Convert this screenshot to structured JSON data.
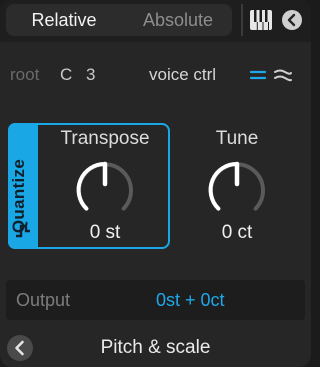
{
  "mode_tabs": [
    {
      "label": "Relative",
      "active": true
    },
    {
      "label": "Absolute",
      "active": false
    }
  ],
  "icons": {
    "keyboard": "piano-keyboard-icon",
    "back_top": "chevron-left-circle-icon",
    "voice_parallel": "parallel-lines-icon",
    "voice_wavy": "wavy-lines-icon",
    "quantize_step": "step-icon",
    "back_bottom": "chevron-left-circle-icon"
  },
  "root": {
    "label": "root",
    "note": "C",
    "octave": "3"
  },
  "voice": {
    "label": "voice ctrl"
  },
  "quantize": {
    "label": "Quantize",
    "enabled": true
  },
  "transpose": {
    "title": "Transpose",
    "value": "0 st"
  },
  "tune": {
    "title": "Tune",
    "value": "0 ct"
  },
  "output": {
    "label": "Output",
    "value": "0st + 0ct"
  },
  "footer": {
    "title": "Pitch & scale"
  },
  "colors": {
    "accent": "#1aa7e6",
    "background": "#262626",
    "knob_track": "#5a5a5a",
    "knob_indicator": "#ffffff"
  }
}
